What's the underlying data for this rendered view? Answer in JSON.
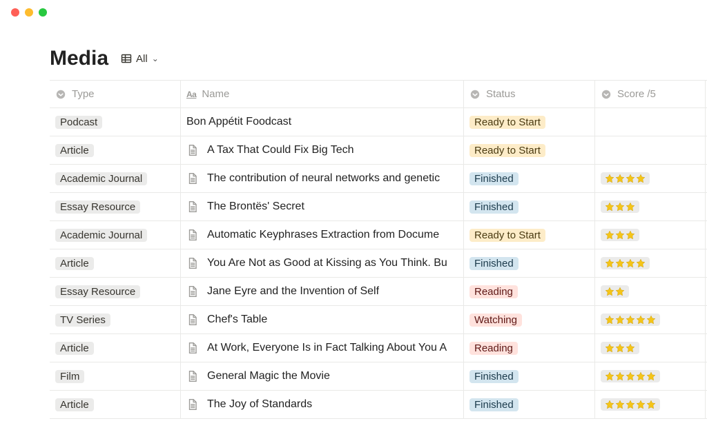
{
  "header": {
    "title": "Media",
    "view_label": "All"
  },
  "columns": {
    "type": "Type",
    "name": "Name",
    "status": "Status",
    "score": "Score /5"
  },
  "status_colors": {
    "Ready to Start": "pill-ready",
    "Finished": "pill-finished",
    "Reading": "pill-reading",
    "Watching": "pill-watching"
  },
  "rows": [
    {
      "type": "Podcast",
      "name": "Bon Appétit Foodcast",
      "has_page_icon": false,
      "status": "Ready to Start",
      "score": null
    },
    {
      "type": "Article",
      "name": "A Tax That Could Fix Big Tech",
      "has_page_icon": true,
      "status": "Ready to Start",
      "score": null
    },
    {
      "type": "Academic Journal",
      "name": "The contribution of neural networks and genetic",
      "has_page_icon": true,
      "status": "Finished",
      "score": 4
    },
    {
      "type": "Essay Resource",
      "name": "The Brontës' Secret",
      "has_page_icon": true,
      "status": "Finished",
      "score": 3
    },
    {
      "type": "Academic Journal",
      "name": "Automatic Keyphrases Extraction from Docume",
      "has_page_icon": true,
      "status": "Ready to Start",
      "score": 3
    },
    {
      "type": "Article",
      "name": "You Are Not as Good at Kissing as You Think. Bu",
      "has_page_icon": true,
      "status": "Finished",
      "score": 4
    },
    {
      "type": "Essay Resource",
      "name": "Jane Eyre and the Invention of Self",
      "has_page_icon": true,
      "status": "Reading",
      "score": 2
    },
    {
      "type": "TV Series",
      "name": "Chef's Table",
      "has_page_icon": true,
      "status": "Watching",
      "score": 5
    },
    {
      "type": "Article",
      "name": "At Work, Everyone Is in Fact Talking About You A",
      "has_page_icon": true,
      "status": "Reading",
      "score": 3
    },
    {
      "type": "Film",
      "name": "General Magic the Movie",
      "has_page_icon": true,
      "status": "Finished",
      "score": 5
    },
    {
      "type": "Article",
      "name": "The Joy of Standards",
      "has_page_icon": true,
      "status": "Finished",
      "score": 5
    }
  ]
}
